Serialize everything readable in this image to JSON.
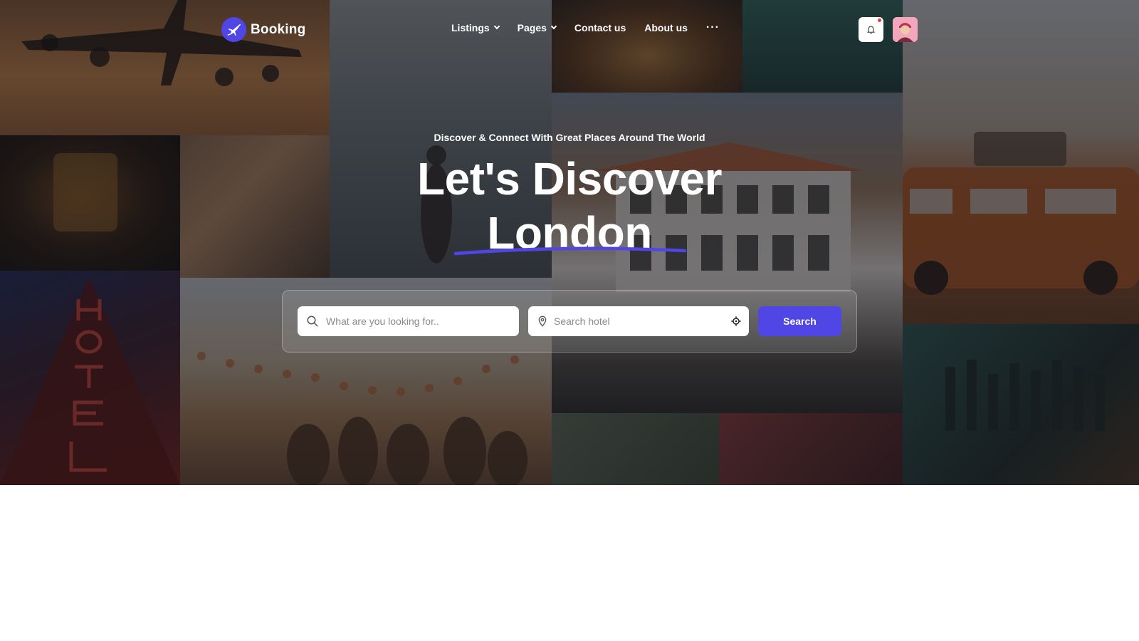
{
  "brand": {
    "name": "Booking",
    "accent": "#5046e5"
  },
  "nav": {
    "items": [
      {
        "label": "Listings",
        "dropdown": true
      },
      {
        "label": "Pages",
        "dropdown": true
      },
      {
        "label": "Contact us",
        "dropdown": false
      },
      {
        "label": "About us",
        "dropdown": false
      }
    ],
    "more": "···"
  },
  "header": {
    "notification_icon": "bell-icon",
    "has_unread": true,
    "avatar": "user-avatar"
  },
  "hero": {
    "subtitle": "Discover & Connect With Great Places Around The World",
    "headline_line1": "Let's Discover",
    "headline_line2": "London"
  },
  "search": {
    "keyword_placeholder": "What are you looking for..",
    "location_placeholder": "Search hotel",
    "button_label": "Search"
  }
}
